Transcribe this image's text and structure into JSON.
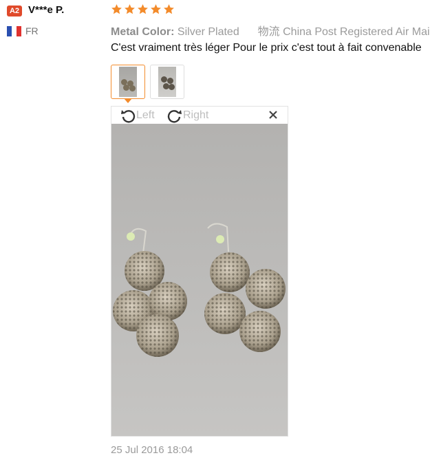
{
  "reviewer": {
    "badge": "A2",
    "name": "V***e P.",
    "country_code": "FR",
    "flag_colors": [
      "#2a4fb0",
      "#ffffff",
      "#e0322f"
    ]
  },
  "rating": {
    "stars": 5,
    "max": 5,
    "color": "#f38b2b"
  },
  "attributes": {
    "label": "Metal Color:",
    "value": "Silver Plated",
    "shipping_label": "物流",
    "shipping_value": "China Post Registered Air Mail"
  },
  "comment": "C'est vraiment très léger Pour le prix c'est tout à fait convenable",
  "thumbnails": [
    {
      "name": "photo-1",
      "selected": true
    },
    {
      "name": "photo-2",
      "selected": false
    }
  ],
  "viewer": {
    "rotate_left_label": "Left",
    "rotate_right_label": "Right",
    "close_icon": "close-icon"
  },
  "date": "25 Jul 2016 18:04"
}
